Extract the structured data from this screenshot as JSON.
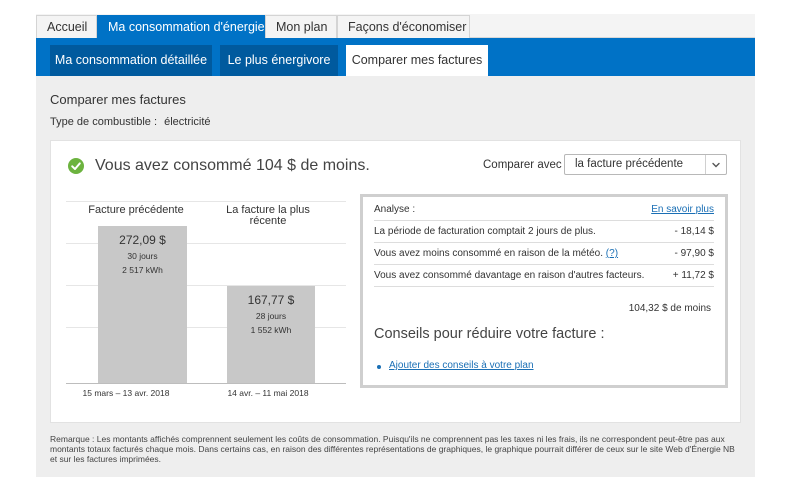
{
  "tabs": [
    "Accueil",
    "Ma consommation d'énergie",
    "Mon plan",
    "Façons d'économiser"
  ],
  "subtabs": [
    "Ma consommation détaillée",
    "Le plus énergivore",
    "Comparer mes factures"
  ],
  "page": {
    "title": "Comparer mes factures",
    "fuel_label": "Type de combustible :",
    "fuel_value": "électricité"
  },
  "summary": {
    "headline": "Vous avez consommé 104 $ de moins.",
    "compare_label": "Comparer avec :",
    "compare_value": "la facture précédente"
  },
  "icons": {
    "check": "check-circle-icon",
    "dropdown": "chevron-down-icon"
  },
  "colors": {
    "brand_blue": "#0072c6",
    "subtab_blue": "#005a9e",
    "success_green": "#6cb33f",
    "bar_gray": "#c8c8c8",
    "link_blue": "#1a6fb5"
  },
  "bills": {
    "previous": {
      "header": "Facture précédente",
      "amount": "272,09 $",
      "days": "30 jours",
      "kwh": "2 517 kWh",
      "period": "15 mars – 13 avr. 2018"
    },
    "recent": {
      "header": "La facture la plus récente",
      "amount": "167,77 $",
      "days": "28 jours",
      "kwh": "1 552 kWh",
      "period": "14 avr. – 11 mai 2018"
    }
  },
  "chart_data": {
    "type": "bar",
    "categories": [
      "Facture précédente",
      "La facture la plus récente"
    ],
    "values": [
      272.09,
      167.77
    ],
    "days": [
      30,
      28
    ],
    "kwh": [
      2517,
      1552
    ],
    "periods": [
      "15 mars – 13 avr. 2018",
      "14 avr. – 11 mai 2018"
    ],
    "ylim": [
      0,
      300
    ],
    "grid": true
  },
  "analysis": {
    "label": "Analyse :",
    "learn_more": "En savoir plus",
    "rows": [
      {
        "label": "La période de facturation comptait 2 jours de plus.",
        "amount": "- 18,14 $"
      },
      {
        "label": "Vous avez moins consommé en raison de la météo.",
        "help": "(?)",
        "amount": "- 97,90 $"
      },
      {
        "label": "Vous avez consommé davantage en raison d'autres facteurs.",
        "amount": "+ 11,72 $"
      }
    ],
    "total": "104,32 $ de moins"
  },
  "tips": {
    "title": "Conseils pour réduire votre facture :",
    "link": "Ajouter des conseils à votre plan"
  },
  "note": "Remarque : Les montants affichés comprennent seulement les coûts de consommation. Puisqu'ils ne comprennent pas les taxes ni les frais, ils ne correspondent peut-être pas aux montants totaux facturés chaque mois. Dans certains cas, en raison des différentes représentations de graphiques, le graphique pourrait différer de ceux sur le site Web d'Énergie NB et sur les factures imprimées."
}
